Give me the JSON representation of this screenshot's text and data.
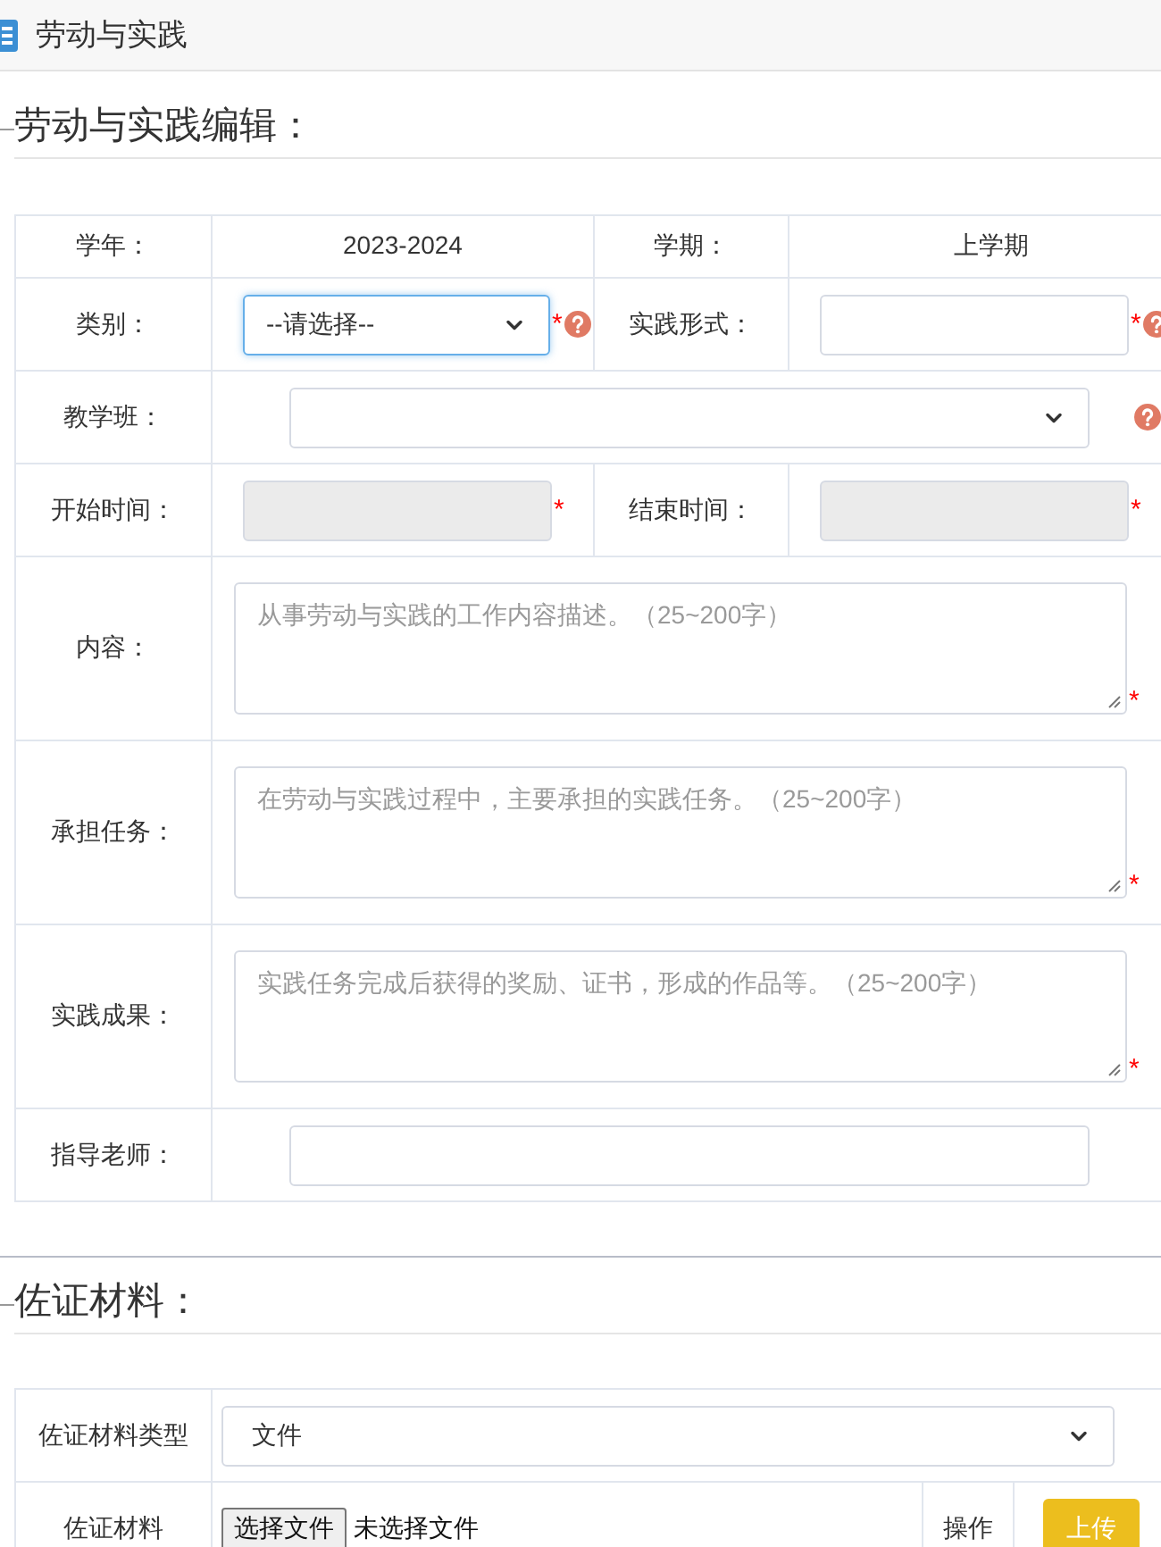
{
  "header": {
    "title": "劳动与实践"
  },
  "edit_section": {
    "title": "劳动与实践编辑：",
    "rows": [
      {
        "cells": [
          {
            "label": "学年：",
            "value": "2023-2024"
          },
          {
            "label": "学期：",
            "value": "上学期"
          }
        ]
      },
      {
        "cells": [
          {
            "label": "类别：",
            "field": {
              "kind": "select",
              "value": "--请选择--",
              "focused": true,
              "required_mark": "*",
              "help": true
            }
          },
          {
            "label": "实践形式：",
            "field": {
              "kind": "input",
              "focused": false,
              "disabled": false,
              "required_mark": "*",
              "help": true
            }
          }
        ]
      },
      {
        "cells": [
          {
            "label": "教学班：",
            "field": {
              "kind": "select",
              "focused": false,
              "help": true
            }
          }
        ]
      },
      {
        "cells": [
          {
            "label": "开始时间：",
            "field": {
              "kind": "input",
              "focused": false,
              "disabled": true,
              "required_mark": "*"
            }
          },
          {
            "label": "结束时间：",
            "field": {
              "kind": "input",
              "focused": false,
              "disabled": true,
              "required_mark": "*"
            }
          }
        ]
      },
      {
        "cells": [
          {
            "label": "内容：",
            "field": {
              "kind": "textarea",
              "placeholder": "从事劳动与实践的工作内容描述。（25~200字）",
              "required_mark": "*"
            }
          }
        ]
      },
      {
        "cells": [
          {
            "label": "承担任务：",
            "field": {
              "kind": "textarea",
              "placeholder": "在劳动与实践过程中，主要承担的实践任务。（25~200字）",
              "required_mark": "*"
            }
          }
        ]
      },
      {
        "cells": [
          {
            "label": "实践成果：",
            "field": {
              "kind": "textarea",
              "placeholder": "实践任务完成后获得的奖励、证书，形成的作品等。（25~200字）",
              "required_mark": "*"
            }
          }
        ]
      },
      {
        "cells": [
          {
            "label": "指导老师：",
            "field": {
              "kind": "input",
              "focused": false,
              "disabled": false
            }
          }
        ]
      }
    ]
  },
  "evidence_section": {
    "title": "佐证材料：",
    "type_row": {
      "label": "佐证材料类型",
      "value": "文件"
    },
    "file_row": {
      "label": "佐证材料",
      "choose_button": "选择文件",
      "file_status": "未选择文件",
      "action_label": "操作",
      "upload_button": "上传"
    }
  }
}
